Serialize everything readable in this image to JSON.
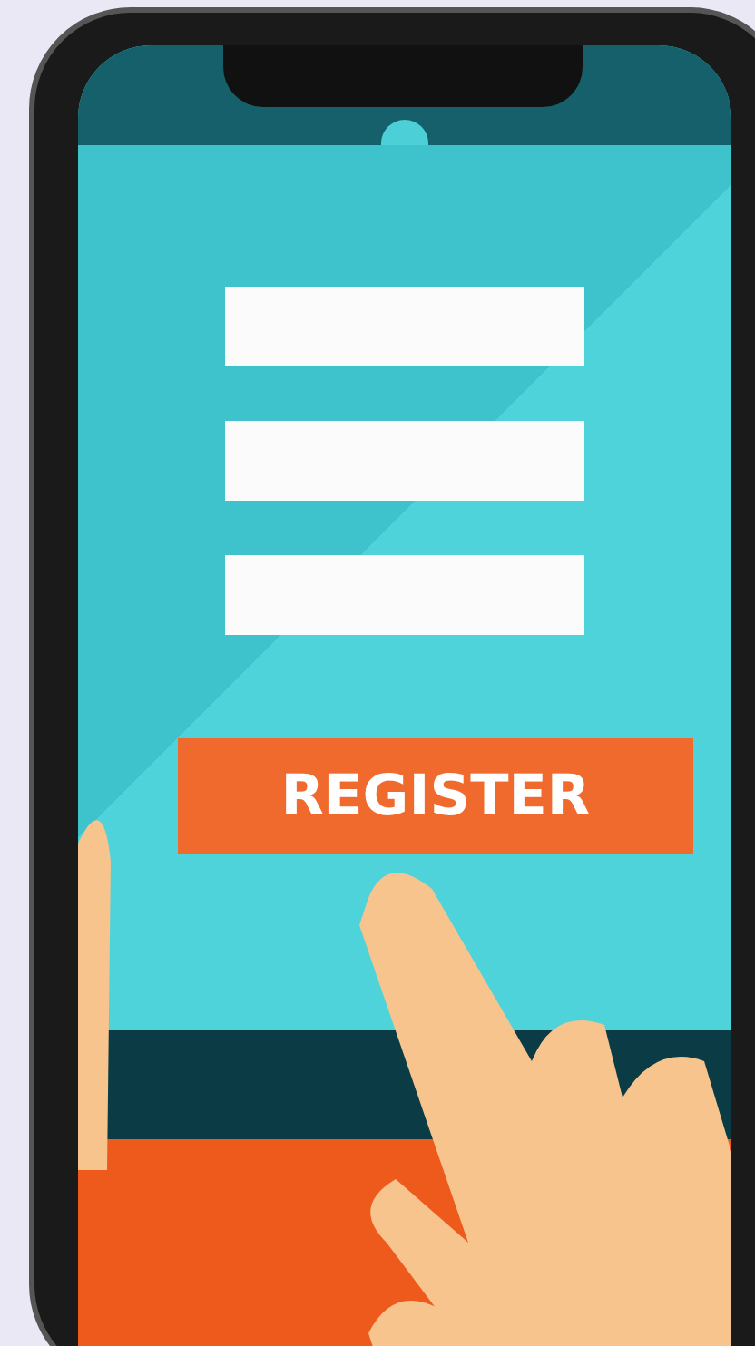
{
  "register_button": {
    "label": "REGISTER"
  }
}
